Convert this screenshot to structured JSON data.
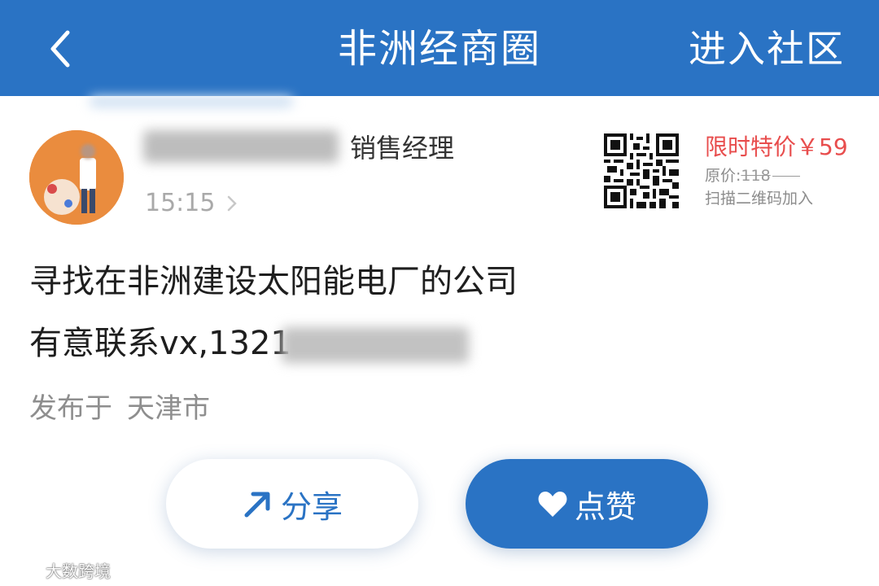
{
  "header": {
    "title": "非洲经商圈",
    "enter_label": "进入社区"
  },
  "post": {
    "author_role": "销售经理",
    "time": "15:15",
    "content_line1": "寻找在非洲建设太阳能电厂的公司",
    "content_line2": "有意联系vx,1321",
    "location_prefix": "发布于",
    "location_city": "天津市"
  },
  "promo": {
    "special_price": "限时特价￥59",
    "original_label": "原价:",
    "original_price": "118",
    "scan_hint": "扫描二维码加入"
  },
  "actions": {
    "share_label": "分享",
    "like_label": "点赞"
  },
  "watermark": {
    "text": "大数跨境"
  },
  "colors": {
    "brand_blue": "#2a73c4",
    "price_red": "#e84d4d"
  },
  "icons": {
    "back": "chevron-left-icon",
    "share": "arrow-up-right-icon",
    "like": "heart-icon",
    "qr": "qr-code-icon"
  }
}
